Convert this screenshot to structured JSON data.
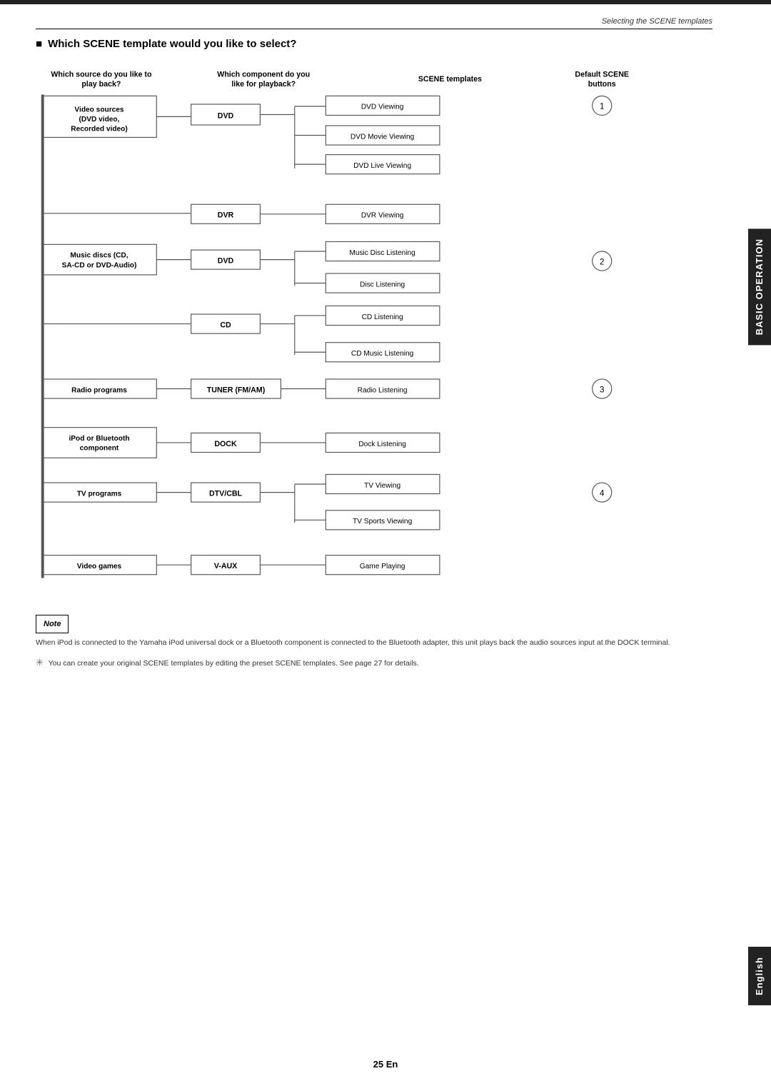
{
  "header": {
    "top_label": "Selecting the SCENE templates"
  },
  "section": {
    "title": "Which SCENE template would you like to select?"
  },
  "columns": {
    "col1": "Which source do you like to\nplay back?",
    "col2": "Which component do you\nlike for playback?",
    "col3": "SCENE templates",
    "col4": "Default SCENE\nbuttons"
  },
  "sources": [
    {
      "label": "Video sources\n(DVD video,\nRecorded video)",
      "components": [
        {
          "name": "DVD",
          "scenes": [
            "DVD Viewing",
            "DVD Movie Viewing",
            "DVD Live Viewing"
          ]
        }
      ]
    },
    {
      "label": "",
      "components": [
        {
          "name": "DVR",
          "scenes": [
            "DVR Viewing"
          ]
        }
      ]
    },
    {
      "label": "Music discs (CD,\nSA-CD or DVD-Audio)",
      "components": [
        {
          "name": "DVD",
          "scenes": [
            "Music Disc Listening",
            "Disc Listening"
          ]
        }
      ]
    },
    {
      "label": "",
      "components": [
        {
          "name": "CD",
          "scenes": [
            "CD Listening",
            "CD Music Listening"
          ]
        }
      ]
    },
    {
      "label": "Radio programs",
      "components": [
        {
          "name": "TUNER (FM/AM)",
          "scenes": [
            "Radio Listening"
          ]
        }
      ]
    },
    {
      "label": "iPod or Bluetooth\ncomponent",
      "components": [
        {
          "name": "DOCK",
          "scenes": [
            "Dock Listening"
          ]
        }
      ]
    },
    {
      "label": "TV programs",
      "components": [
        {
          "name": "DTV/CBL",
          "scenes": [
            "TV Viewing",
            "TV Sports Viewing"
          ]
        }
      ]
    },
    {
      "label": "Video games",
      "components": [
        {
          "name": "V-AUX",
          "scenes": [
            "Game Playing"
          ]
        }
      ]
    }
  ],
  "default_buttons": {
    "btn1": "①",
    "btn2": "②",
    "btn3": "③",
    "btn4": "④"
  },
  "note": {
    "title": "Note",
    "text": "When iPod is connected to the Yamaha iPod universal dock or a Bluetooth component is connected to the Bluetooth adapter, this unit plays back the audio sources input at the DOCK terminal.",
    "hint": "You can create your original SCENE templates by editing the preset SCENE templates. See page 27 for details."
  },
  "side_tabs": {
    "operation": "BASIC OPERATION",
    "english": "English"
  },
  "page_number": "25 En"
}
